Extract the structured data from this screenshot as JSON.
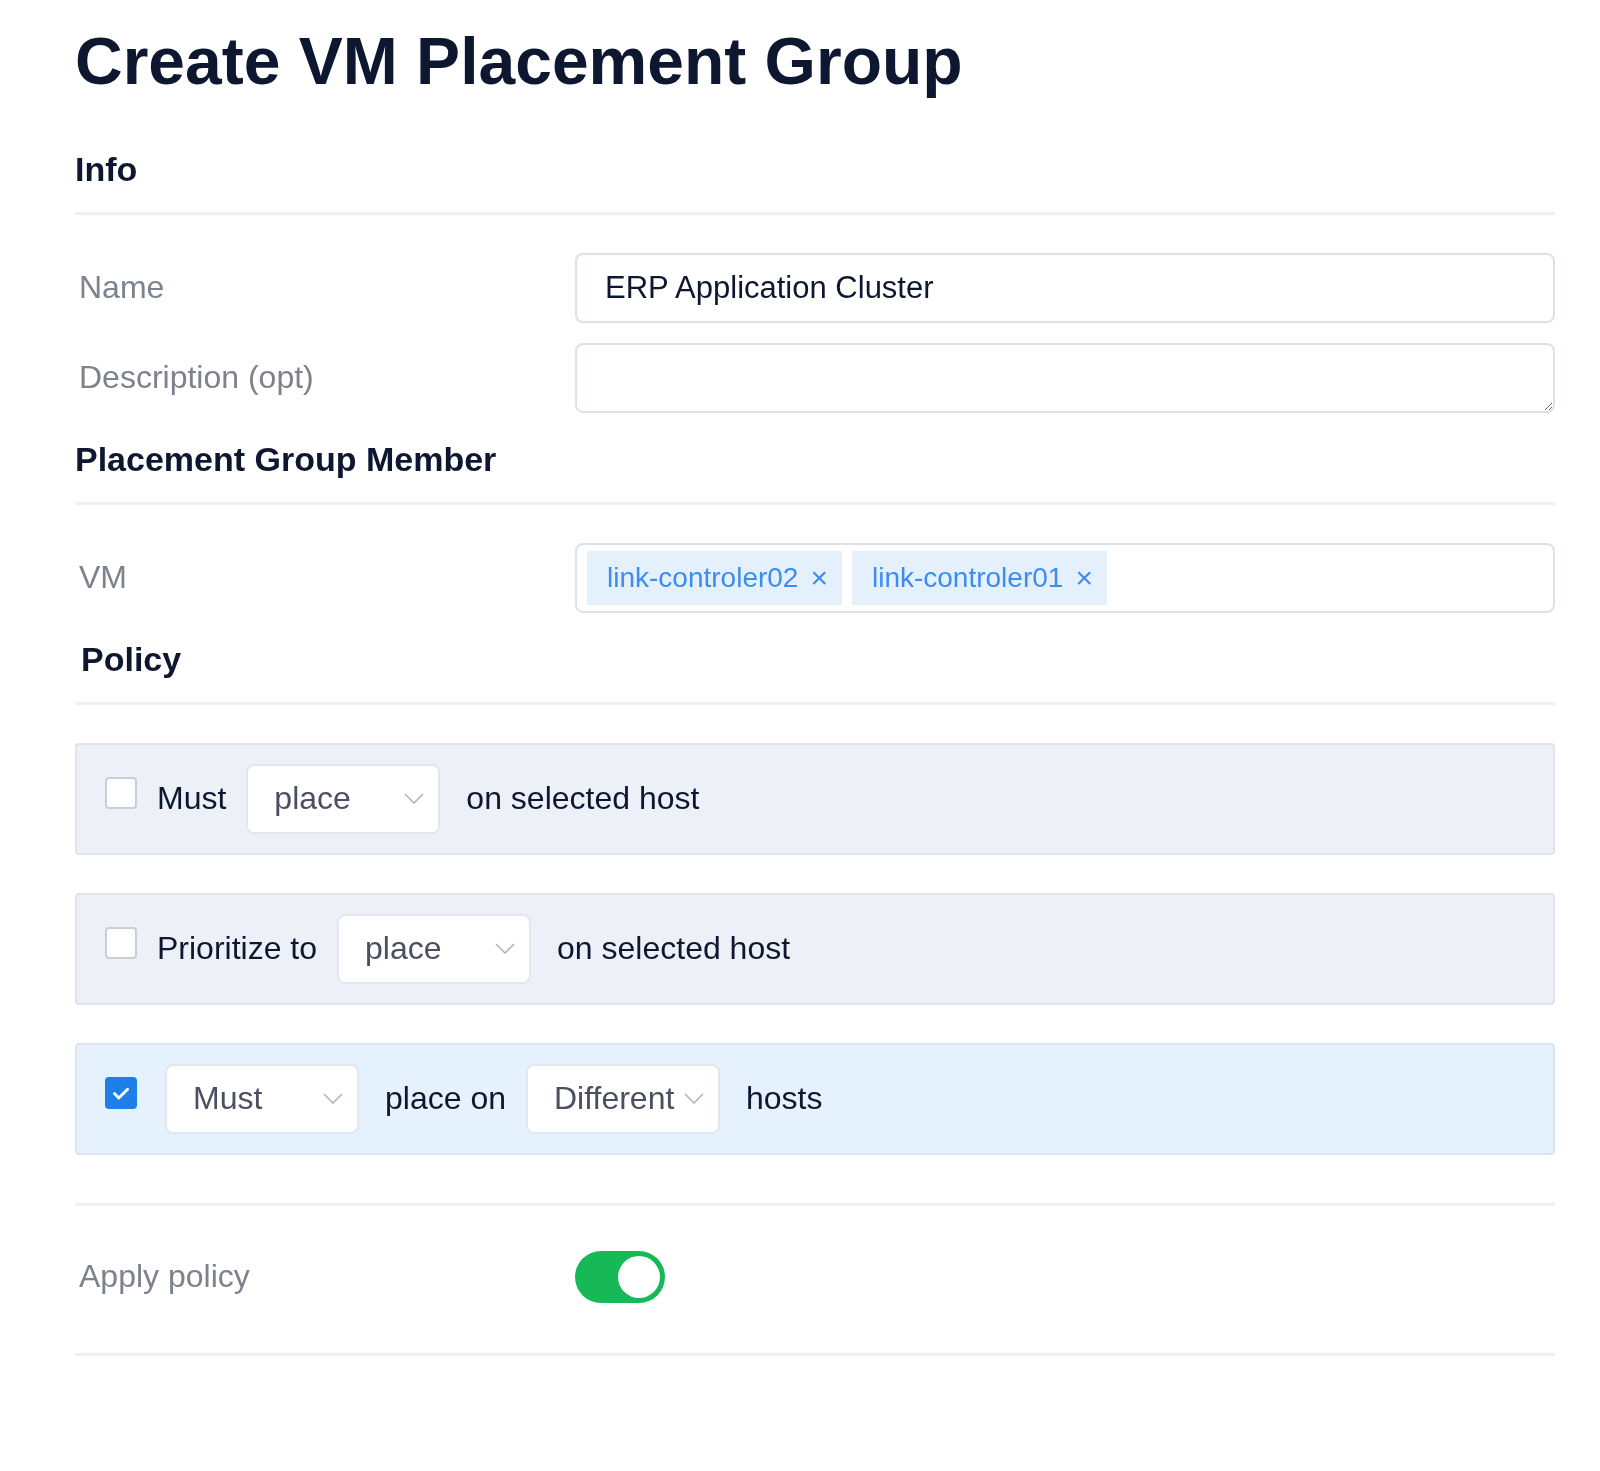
{
  "title": "Create VM Placement Group",
  "sections": [
    {
      "kind": "info",
      "heading": "Info",
      "fields": [
        {
          "kind": "input",
          "label": "Name",
          "value": "ERP Application Cluster"
        },
        {
          "kind": "textarea",
          "label": "Description (opt)"
        }
      ]
    },
    {
      "kind": "member",
      "heading": "Placement Group Member",
      "fields": [
        {
          "kind": "tags",
          "label": "VM",
          "tags": [
            {
              "text": "link-controler02",
              "remove": "×"
            },
            {
              "text": "link-controler01",
              "remove": "×"
            }
          ]
        }
      ]
    },
    {
      "kind": "policy",
      "heading": "Policy",
      "rules": [
        {
          "checked": false,
          "parts": [
            {
              "kind": "text",
              "text": "Must"
            },
            {
              "kind": "select",
              "value": "place"
            },
            {
              "kind": "text",
              "text": "on selected host"
            }
          ]
        },
        {
          "checked": false,
          "parts": [
            {
              "kind": "text",
              "text": "Prioritize to"
            },
            {
              "kind": "select",
              "value": "place"
            },
            {
              "kind": "text",
              "text": "on selected host"
            }
          ]
        },
        {
          "checked": true,
          "parts": [
            {
              "kind": "select",
              "value": "Must"
            },
            {
              "kind": "text",
              "text": "place on"
            },
            {
              "kind": "select",
              "value": "Different"
            },
            {
              "kind": "text",
              "text": "hosts"
            }
          ]
        }
      ]
    }
  ],
  "apply_policy": {
    "label": "Apply policy",
    "on": true
  }
}
